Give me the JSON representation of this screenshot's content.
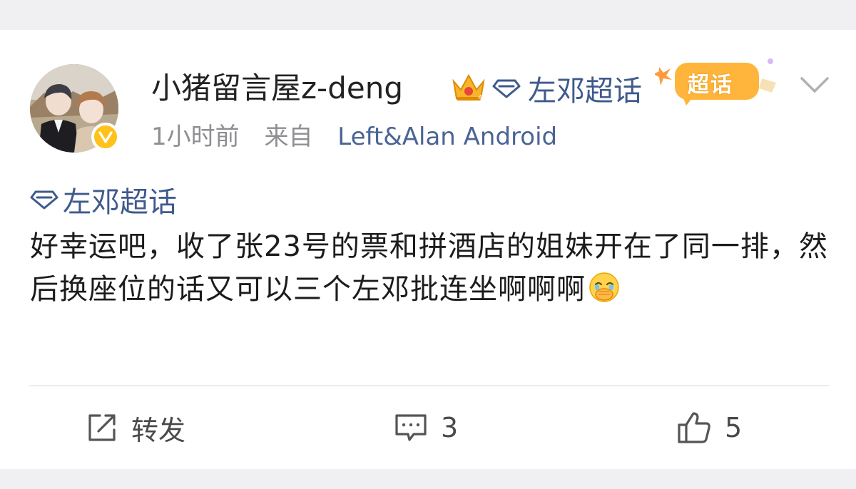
{
  "post": {
    "author": {
      "username": "小猪留言屋z-deng",
      "verified": true
    },
    "header_topic": "左邓超话",
    "super_badge_label": "超话",
    "meta": {
      "time": "1小时前",
      "source_prefix": "来自",
      "source_app": "Left&Alan Android"
    },
    "topic_tag": "左邓超话",
    "text": "好幸运吧，收了张23号的票和拼酒店的姐妹开在了同一排，然后换座位的话又可以三个左邓批连坐啊啊啊",
    "actions": {
      "repost_label": "转发",
      "comment_count": "3",
      "like_count": "5"
    }
  },
  "colors": {
    "topic_blue": "#3f5a8c",
    "meta_gray": "#8e8e93",
    "badge_gold": "#ffc21a",
    "background": "#f0f0f2"
  },
  "icons": [
    "diamond-topic-icon",
    "crown-icon",
    "chevron-down-icon",
    "verified-icon",
    "emoji-cover-mouth-icon",
    "repost-icon",
    "comment-icon",
    "like-icon"
  ]
}
